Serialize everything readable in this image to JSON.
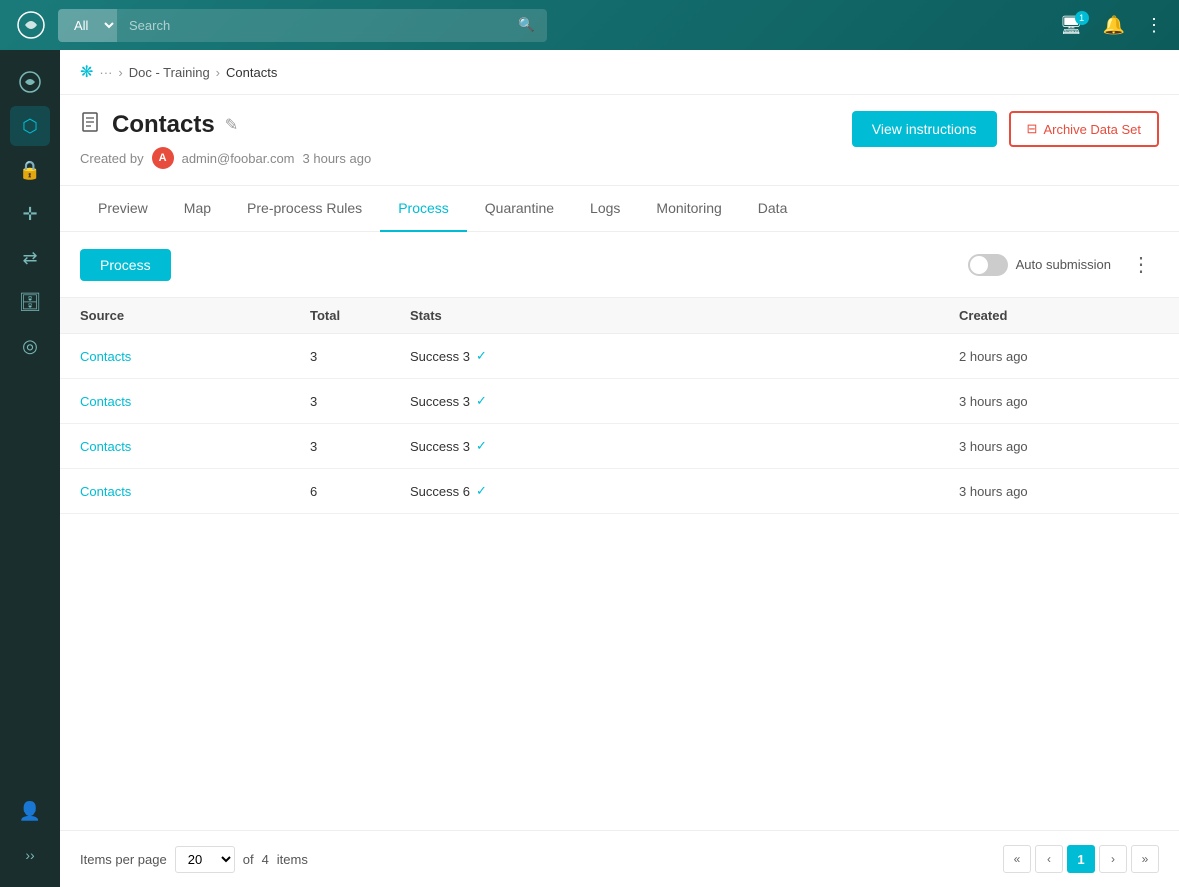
{
  "topNav": {
    "searchPlaceholder": "Search",
    "searchCategory": "All",
    "logoText": "☁"
  },
  "breadcrumb": {
    "iconText": "❋",
    "dots": "···",
    "parent": "Doc - Training",
    "current": "Contacts"
  },
  "pageHeader": {
    "title": "Contacts",
    "editIcon": "✎",
    "docIcon": "📄",
    "metaLabel": "Created by",
    "avatar": "A",
    "email": "admin@foobar.com",
    "timeAgo": "3 hours ago",
    "viewInstructionsBtn": "View instructions",
    "archiveBtn": "Archive Data Set",
    "archiveIcon": "⊟"
  },
  "tabs": [
    {
      "label": "Preview",
      "active": false
    },
    {
      "label": "Map",
      "active": false
    },
    {
      "label": "Pre-process Rules",
      "active": false
    },
    {
      "label": "Process",
      "active": true
    },
    {
      "label": "Quarantine",
      "active": false
    },
    {
      "label": "Logs",
      "active": false
    },
    {
      "label": "Monitoring",
      "active": false
    },
    {
      "label": "Data",
      "active": false
    }
  ],
  "toolbar": {
    "processBtn": "Process",
    "autoSubmissionLabel": "Auto submission"
  },
  "tableColumns": {
    "source": "Source",
    "total": "Total",
    "stats": "Stats",
    "created": "Created"
  },
  "tableRows": [
    {
      "source": "Contacts",
      "total": "3",
      "stats": "Success 3",
      "created": "2 hours ago"
    },
    {
      "source": "Contacts",
      "total": "3",
      "stats": "Success 3",
      "created": "3 hours ago"
    },
    {
      "source": "Contacts",
      "total": "3",
      "stats": "Success 3",
      "created": "3 hours ago"
    },
    {
      "source": "Contacts",
      "total": "6",
      "stats": "Success 6",
      "created": "3 hours ago"
    }
  ],
  "footer": {
    "itemsPerPageLabel": "Items per page",
    "perPageValue": "20",
    "ofLabel": "of",
    "totalItems": "4",
    "itemsLabel": "items",
    "currentPage": "1"
  },
  "sidebar": {
    "items": [
      {
        "icon": "✦",
        "name": "home"
      },
      {
        "icon": "⬡",
        "name": "integrations"
      },
      {
        "icon": "🔒",
        "name": "security"
      },
      {
        "icon": "⊕",
        "name": "users"
      },
      {
        "icon": "⇄",
        "name": "flows"
      },
      {
        "icon": "🗄",
        "name": "database"
      },
      {
        "icon": "⬡",
        "name": "analytics"
      },
      {
        "icon": "👤",
        "name": "profile"
      }
    ]
  }
}
